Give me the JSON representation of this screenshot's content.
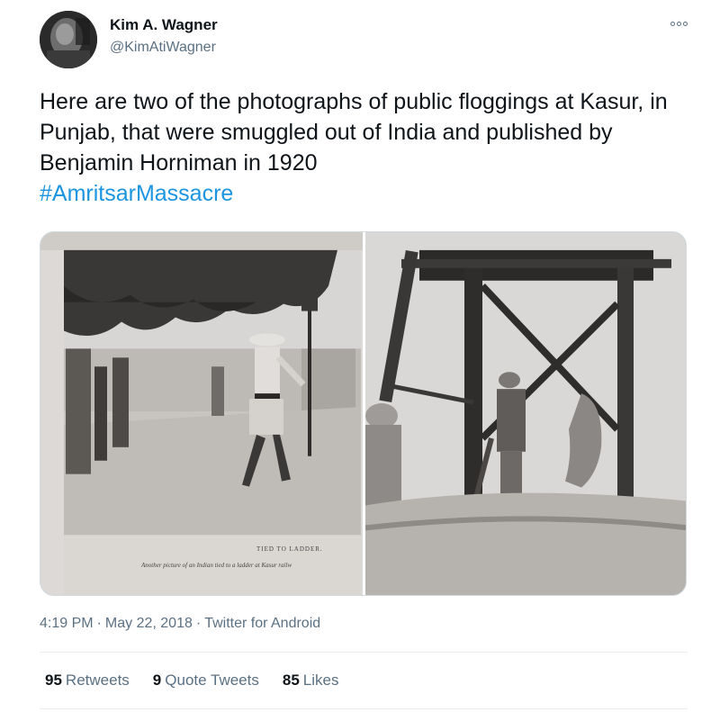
{
  "author": {
    "display_name": "Kim A. Wagner",
    "handle": "@KimAtiWagner",
    "avatar_icon": "profile-photo"
  },
  "menu": {
    "icon": "more-options-icon"
  },
  "tweet": {
    "text": "Here are two of the photographs of public floggings at Kasur, in Punjab, that were smuggled out of India and published by Benjamin Horniman in 1920",
    "hashtag": "#AmritsarMassacre",
    "hashtag_color": "#1b95e0"
  },
  "media": {
    "photo_left": {
      "caption_title": "TIED TO LADDER.",
      "caption_sub": "Another picture of an Indian tied to a ladder at Kasur railw"
    },
    "photo_right": {}
  },
  "meta": {
    "time": "4:19 PM",
    "date": "May 22, 2018",
    "source": "Twitter for Android"
  },
  "stats": {
    "retweets_count": "95",
    "retweets_label": "Retweets",
    "quotes_count": "9",
    "quotes_label": "Quote Tweets",
    "likes_count": "85",
    "likes_label": "Likes"
  }
}
